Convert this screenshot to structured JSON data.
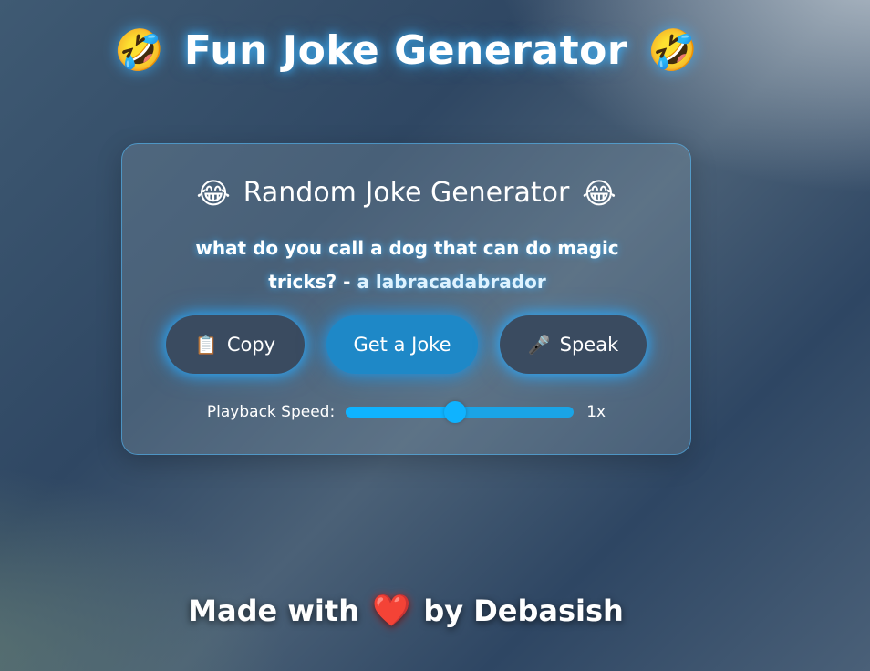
{
  "header": {
    "title": "Fun Joke Generator",
    "emoji_left": "🤣",
    "emoji_right": "🤣"
  },
  "card": {
    "title": "Random Joke Generator",
    "emoji_left": "😂",
    "emoji_right": "😂",
    "joke": {
      "question": "what do you call a dog that can do magic tricks? -",
      "answer": "a labracadabrador"
    },
    "buttons": {
      "copy": {
        "icon": "📋",
        "label": "Copy"
      },
      "get_joke": {
        "label": "Get a Joke"
      },
      "speak": {
        "icon": "🎤",
        "label": "Speak"
      }
    },
    "speed": {
      "label": "Playback Speed:",
      "value_text": "1x",
      "level_fraction": 0.48
    }
  },
  "footer": {
    "prefix": "Made with",
    "heart": "❤️",
    "suffix": "by Debasish"
  },
  "colors": {
    "accent": "#0fb3ff",
    "glow": "#28aaff",
    "button_dark": "#3a4b60",
    "button_primary": "#1e88c7"
  }
}
